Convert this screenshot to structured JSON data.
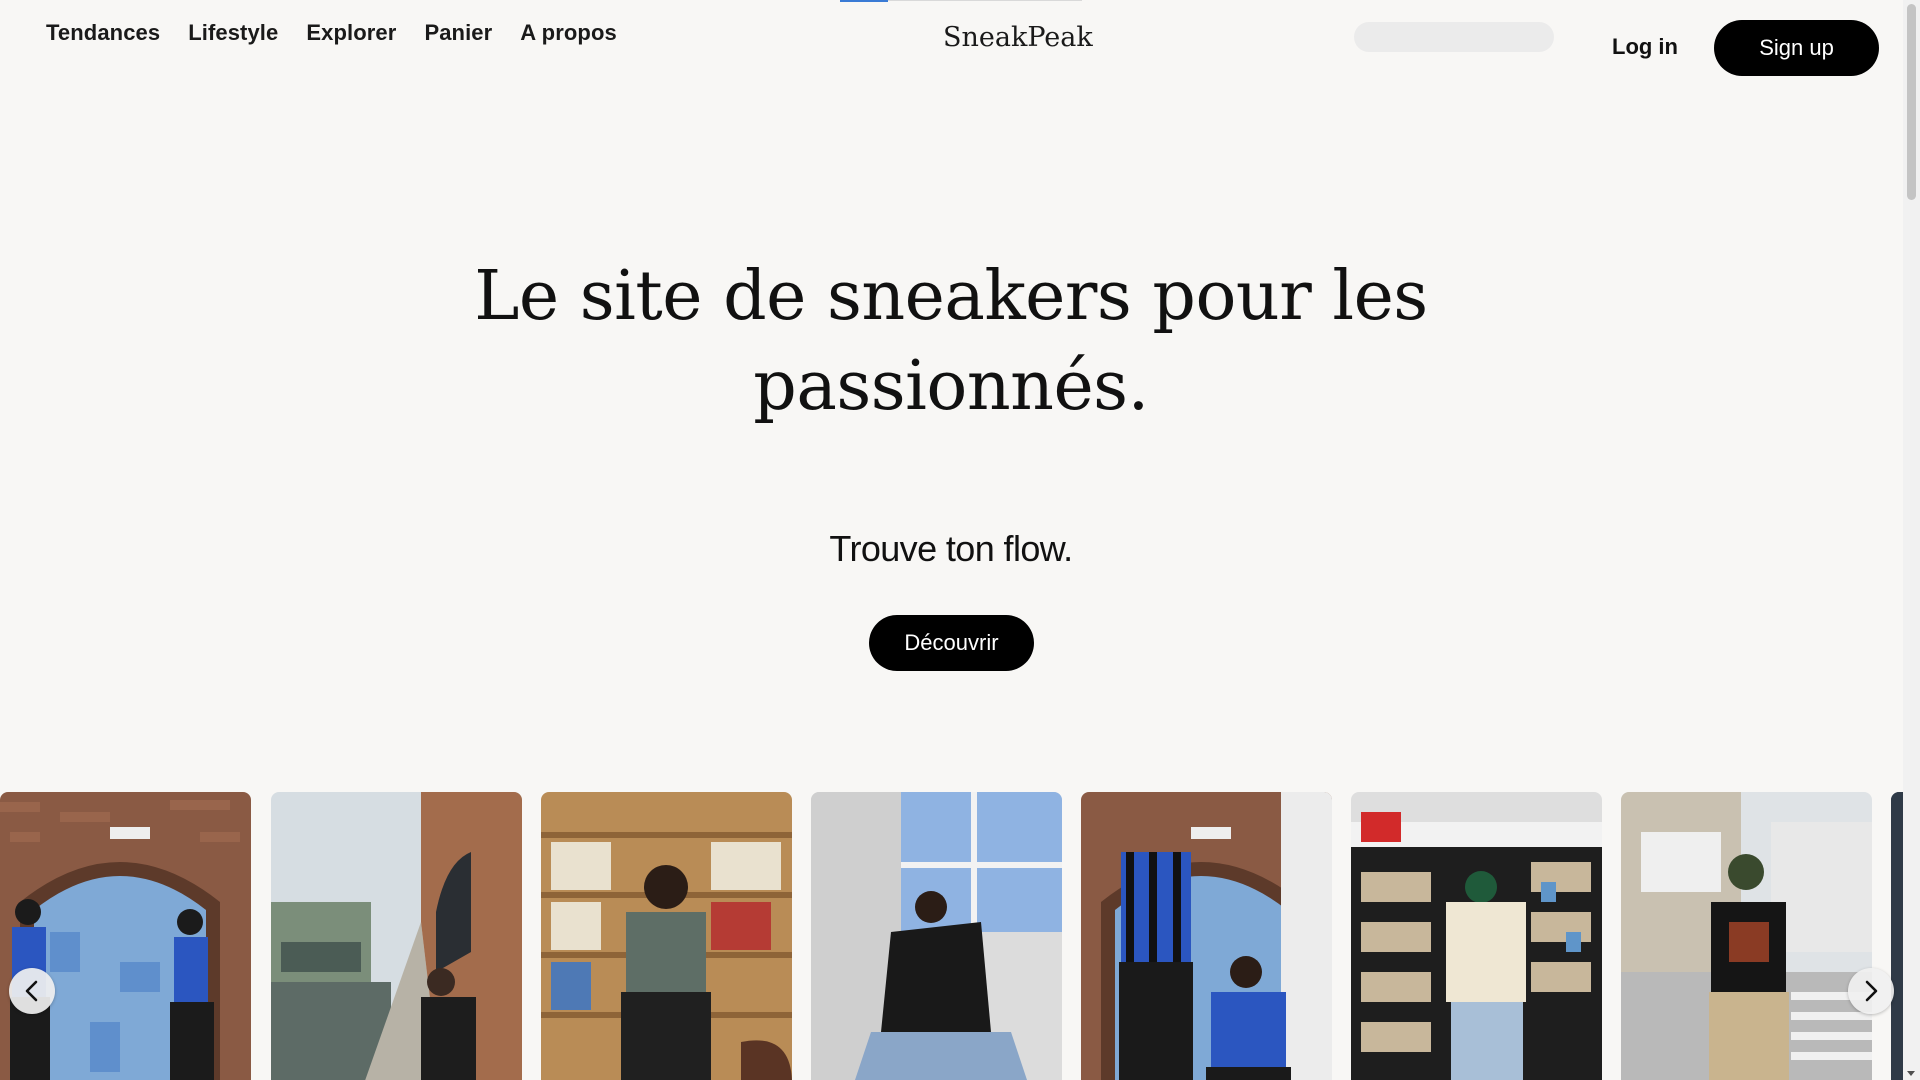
{
  "nav": {
    "items": [
      {
        "label": "Tendances"
      },
      {
        "label": "Lifestyle"
      },
      {
        "label": "Explorer"
      },
      {
        "label": "Panier"
      },
      {
        "label": "A propos"
      }
    ]
  },
  "brand": {
    "name": "SneakPeak"
  },
  "search": {
    "placeholder": "",
    "value": ""
  },
  "auth": {
    "login_label": "Log in",
    "signup_label": "Sign up"
  },
  "hero": {
    "title": "Le site de sneakers pour les passionnés.",
    "subtitle": "Trouve ton flow.",
    "cta_label": "Découvrir"
  },
  "carousel": {
    "prev_icon": "chevron-left-icon",
    "next_icon": "chevron-right-icon",
    "images": [
      {
        "name": "photo-two-men-blue-door"
      },
      {
        "name": "photo-canal-brick-wall"
      },
      {
        "name": "photo-bookshelf-seated"
      },
      {
        "name": "photo-denim-window"
      },
      {
        "name": "photo-jersey-blue-door"
      },
      {
        "name": "photo-bookstore-shelves"
      },
      {
        "name": "photo-street-crosswalk"
      }
    ]
  },
  "colors": {
    "background": "#f8f7f5",
    "button": "#000000",
    "button_text": "#ffffff",
    "accent": "#3a7bd5"
  }
}
